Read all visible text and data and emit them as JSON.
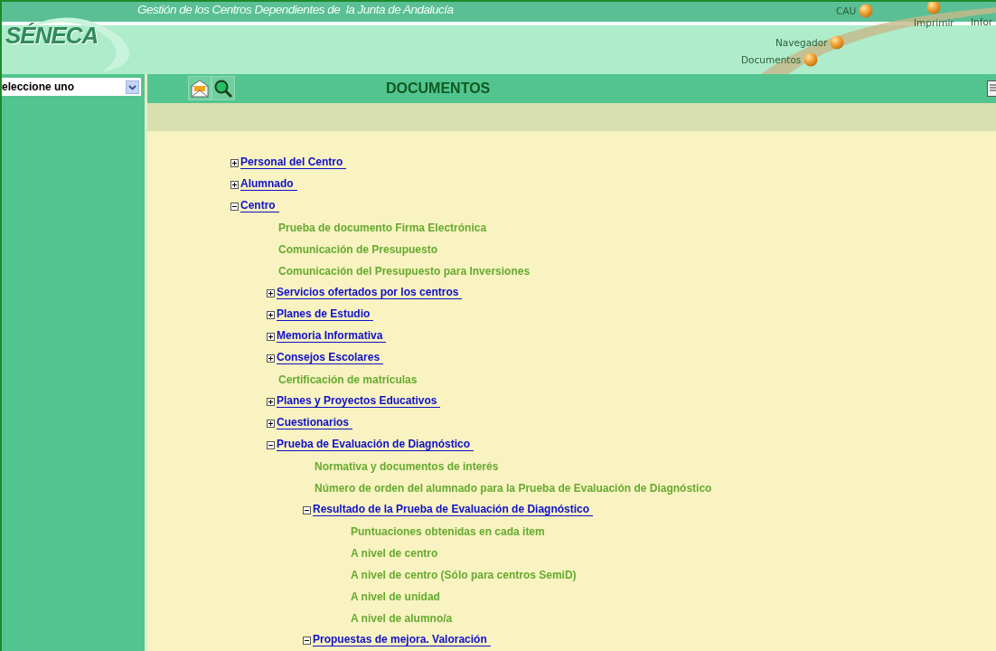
{
  "app": {
    "logo": "SÉNECA",
    "title": "Gestión de los Centros Dependientes de  la Junta de Andalucía"
  },
  "nav": [
    {
      "label": "CAU"
    },
    {
      "label": "Imprimir"
    },
    {
      "label": "Infor"
    },
    {
      "label": "Navegador"
    },
    {
      "label": "Documentos"
    }
  ],
  "sidebar": {
    "select": {
      "value": "eleccione uno"
    }
  },
  "page": {
    "title": "DOCUMENTOS"
  },
  "tree": [
    {
      "kind": "folder",
      "label": "Personal del Centro",
      "expanded": false
    },
    {
      "kind": "folder",
      "label": "Alumnado",
      "expanded": false
    },
    {
      "kind": "folder",
      "label": "Centro",
      "expanded": true,
      "children": [
        {
          "kind": "document",
          "label": "Prueba de documento Firma Electrónica"
        },
        {
          "kind": "document",
          "label": "Comunicación de Presupuesto"
        },
        {
          "kind": "document",
          "label": "Comunicación del Presupuesto para Inversiones"
        },
        {
          "kind": "folder",
          "label": "Servicios ofertados por los centros",
          "expanded": false
        },
        {
          "kind": "folder",
          "label": "Planes de Estudio",
          "expanded": false
        },
        {
          "kind": "folder",
          "label": "Memoria Informativa",
          "expanded": false
        },
        {
          "kind": "folder",
          "label": "Consejos Escolares",
          "expanded": false
        },
        {
          "kind": "document",
          "label": "Certificación de matrículas"
        },
        {
          "kind": "folder",
          "label": "Planes y Proyectos Educativos",
          "expanded": false
        },
        {
          "kind": "folder",
          "label": "Cuestionarios",
          "expanded": false
        },
        {
          "kind": "folder",
          "label": "Prueba de Evaluación de Diagnóstico",
          "expanded": true,
          "children": [
            {
              "kind": "document",
              "label": "Normativa y documentos de interés"
            },
            {
              "kind": "document",
              "label": "Número de orden del alumnado para la Prueba de Evaluación de Diagnóstico"
            },
            {
              "kind": "folder",
              "label": "Resultado de la Prueba de Evaluación de Diagnóstico",
              "expanded": true,
              "children": [
                {
                  "kind": "document",
                  "label": "Puntuaciones obtenidas en cada item"
                },
                {
                  "kind": "document",
                  "label": "A nivel de centro"
                },
                {
                  "kind": "document",
                  "label": "A nivel de centro (Sólo para centros SemiD)"
                },
                {
                  "kind": "document",
                  "label": "A nivel de unidad"
                },
                {
                  "kind": "document",
                  "label": "A nivel de alumno/a"
                }
              ]
            },
            {
              "kind": "folder",
              "label": "Propuestas de mejora. Valoración",
              "expanded": true
            }
          ]
        }
      ]
    }
  ]
}
